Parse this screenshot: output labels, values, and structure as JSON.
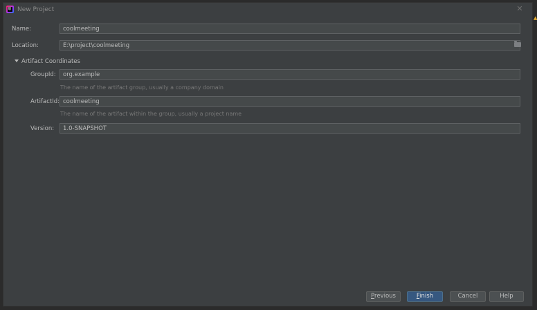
{
  "window": {
    "title": "New Project",
    "app_icon_text": "IJ"
  },
  "form": {
    "name_label": "Name:",
    "name_value": "coolmeeting",
    "location_label": "Location:",
    "location_value": "E:\\project\\coolmeeting",
    "section_label": "Artifact Coordinates",
    "groupid_label": "GroupId:",
    "groupid_value": "org.example",
    "groupid_hint": "The name of the artifact group, usually a company domain",
    "artifactid_label": "ArtifactId:",
    "artifactid_value": "coolmeeting",
    "artifactid_hint": "The name of the artifact within the group, usually a project name",
    "version_label": "Version:",
    "version_value": "1.0-SNAPSHOT"
  },
  "buttons": {
    "previous_first": "P",
    "previous_rest": "revious",
    "finish_first": "F",
    "finish_rest": "inish",
    "cancel": "Cancel",
    "help": "Help"
  },
  "icons": {
    "close": "close-icon",
    "folder": "folder-icon",
    "expand": "triangle-down-icon",
    "app": "intellij-idea-icon"
  },
  "colors": {
    "background": "#3c3f41",
    "field_background": "#45494a",
    "primary_button": "#365880",
    "text": "#bbbbbb",
    "hint_text": "#787878"
  }
}
